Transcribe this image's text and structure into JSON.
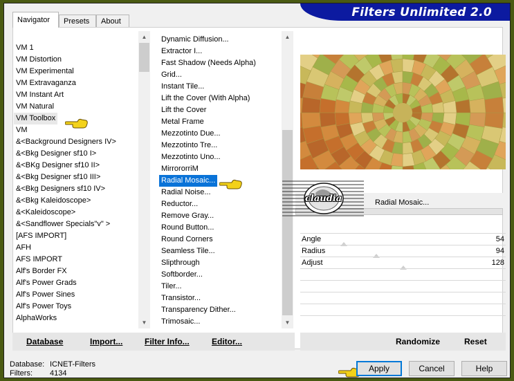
{
  "app": {
    "title": "Filters Unlimited 2.0"
  },
  "tabs": [
    {
      "label": "Navigator"
    },
    {
      "label": "Presets"
    },
    {
      "label": "About"
    }
  ],
  "categories": [
    "VM 1",
    "VM Distortion",
    "VM Experimental",
    "VM Extravaganza",
    "VM Instant Art",
    "VM Natural",
    "VM Toolbox",
    "VM",
    "&<Background Designers IV>",
    "&<Bkg Designer sf10 I>",
    "&<BKg Designer sf10 II>",
    "&<Bkg Designer sf10 III>",
    "&<Bkg Designers sf10 IV>",
    "&<Bkg Kaleidoscope>",
    "&<Kaleidoscope>",
    "&<Sandflower Specials\"v\" >",
    "[AFS IMPORT]",
    "AFH",
    "AFS IMPORT",
    "Alf's Border FX",
    "Alf's Power Grads",
    "Alf's Power Sines",
    "Alf's Power Toys",
    "AlphaWorks"
  ],
  "filters": [
    "Dynamic Diffusion...",
    "Extractor I...",
    "Fast Shadow (Needs Alpha)",
    "Grid...",
    "Instant Tile...",
    "Lift the Cover (With Alpha)",
    "Lift the Cover",
    "Metal Frame",
    "Mezzotinto Due...",
    "Mezzotinto Tre...",
    "Mezzotinto Uno...",
    "MirrororriM",
    "Radial Mosaic...",
    "Radial Noise...",
    "Reductor...",
    "Remove Gray...",
    "Round Button...",
    "Round Corners",
    "Seamless Tile...",
    "Slipthrough",
    "Softborder...",
    "Tiler...",
    "Transistor...",
    "Transparency Dither...",
    "Trimosaic..."
  ],
  "selected_category": "VM Toolbox",
  "selected_filter": "Radial Mosaic...",
  "filter_name_display": "Radial Mosaic...",
  "params": [
    {
      "label": "Angle",
      "value": "54",
      "fraction": 0.212
    },
    {
      "label": "Radius",
      "value": "94",
      "fraction": 0.369
    },
    {
      "label": "Adjust",
      "value": "128",
      "fraction": 0.502
    }
  ],
  "left_buttons": {
    "database": "Database",
    "import": "Import...",
    "filter_info": "Filter Info...",
    "editor": "Editor..."
  },
  "right_buttons": {
    "randomize": "Randomize",
    "reset": "Reset"
  },
  "dialog_buttons": {
    "apply": "Apply",
    "cancel": "Cancel",
    "help": "Help"
  },
  "info": {
    "database_label": "Database:",
    "database_value": "ICNET-Filters",
    "filters_label": "Filters:",
    "filters_value": "4134"
  },
  "watermark": "claudia",
  "colors": {
    "selection": "#0a73d8",
    "title_banner": "#0c1aa0",
    "outer_frame": "#4a5a12"
  }
}
